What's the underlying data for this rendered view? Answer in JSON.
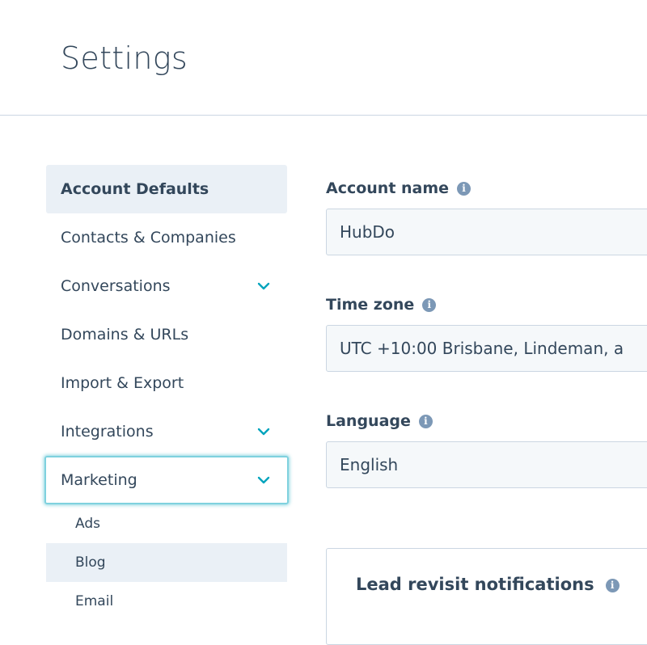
{
  "header": {
    "title": "Settings"
  },
  "sidebar": {
    "items": [
      {
        "label": "Account Defaults"
      },
      {
        "label": "Contacts & Companies"
      },
      {
        "label": "Conversations"
      },
      {
        "label": "Domains & URLs"
      },
      {
        "label": "Import & Export"
      },
      {
        "label": "Integrations"
      },
      {
        "label": "Marketing"
      }
    ],
    "sub_items": [
      {
        "label": "Ads"
      },
      {
        "label": "Blog"
      },
      {
        "label": "Email"
      }
    ]
  },
  "form": {
    "account_name": {
      "label": "Account name",
      "value": "HubDo"
    },
    "time_zone": {
      "label": "Time zone",
      "value": "UTC +10:00 Brisbane, Lindeman, a"
    },
    "language": {
      "label": "Language",
      "value": "English"
    }
  },
  "card": {
    "title": "Lead revisit notifications"
  },
  "colors": {
    "active_bg": "#eaf0f6",
    "accent_teal": "#00a4bd",
    "text": "#33475b"
  }
}
